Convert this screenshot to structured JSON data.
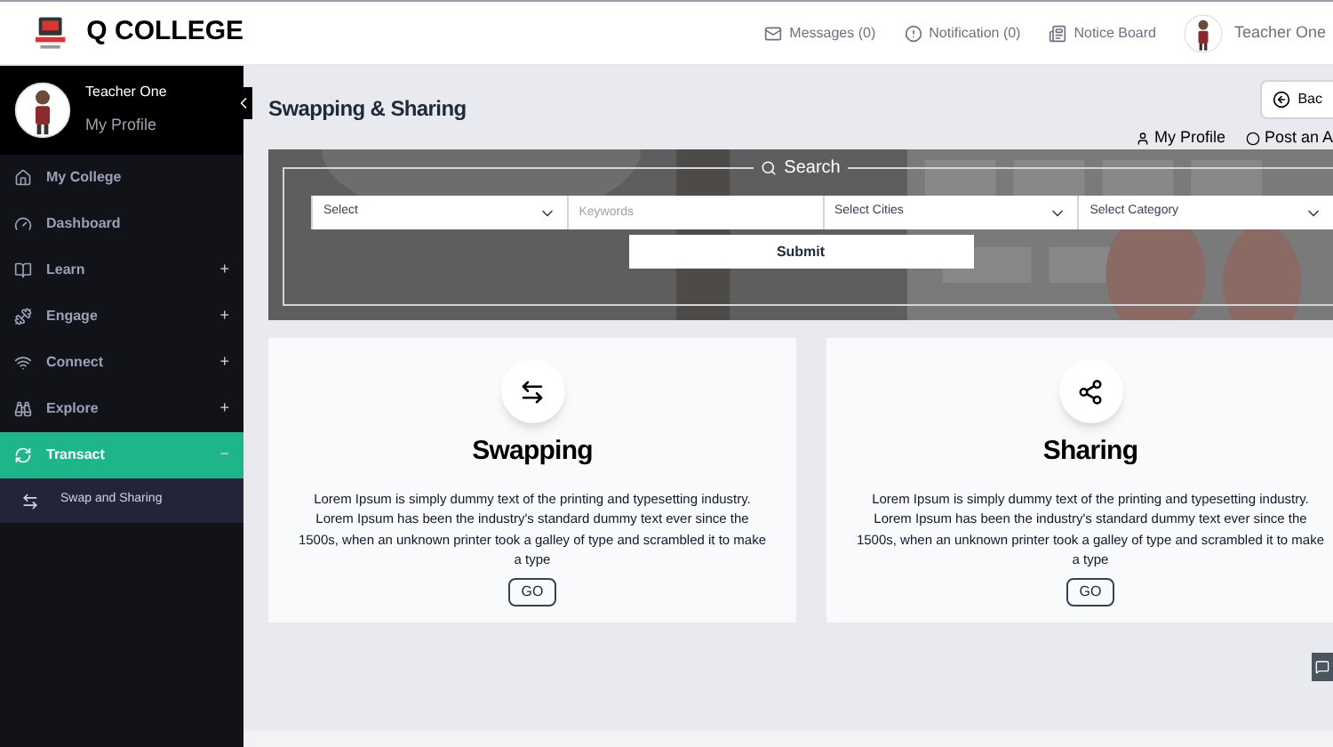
{
  "header": {
    "brand": "Q COLLEGE",
    "nav": [
      {
        "label": "Messages (0)"
      },
      {
        "label": "Notification (0)"
      },
      {
        "label": "Notice Board"
      }
    ],
    "user": "Teacher One"
  },
  "sidebar": {
    "profile": {
      "name": "Teacher One",
      "link": "My Profile"
    },
    "items": [
      {
        "label": "My College",
        "selected": false
      },
      {
        "label": "Dashboard",
        "selected": false
      },
      {
        "label": "Learn",
        "toggle": "+",
        "selected": false
      },
      {
        "label": "Engage",
        "toggle": "+",
        "selected": false
      },
      {
        "label": "Connect",
        "toggle": "+",
        "selected": false
      },
      {
        "label": "Explore",
        "toggle": "+",
        "selected": false
      },
      {
        "label": "Transact",
        "toggle": "−",
        "selected": true,
        "children": [
          {
            "label": "Swap and Sharing"
          }
        ]
      }
    ]
  },
  "main": {
    "title": "Swapping & Sharing",
    "back_button": "Bac",
    "links": [
      {
        "label": "My Profile"
      },
      {
        "label": "Post an A"
      }
    ],
    "search": {
      "legend": "Search",
      "fields": [
        {
          "kind": "select",
          "value": "Select"
        },
        {
          "kind": "input",
          "placeholder": "Keywords"
        },
        {
          "kind": "select",
          "value": "Select Cities"
        },
        {
          "kind": "select",
          "value": "Select Category"
        }
      ],
      "submit": "Submit"
    },
    "cards": [
      {
        "title": "Swapping",
        "text": "Lorem Ipsum is simply dummy text of the printing and typesetting industry. Lorem Ipsum has been the industry's standard dummy text ever since the 1500s, when an unknown printer took a galley of type and scrambled it to make a type",
        "button": "GO"
      },
      {
        "title": "Sharing",
        "text": "Lorem Ipsum is simply dummy text of the printing and typesetting industry. Lorem Ipsum has been the industry's standard dummy text ever since the 1500s, when an unknown printer took a galley of type and scrambled it to make a type",
        "button": "GO"
      }
    ]
  }
}
